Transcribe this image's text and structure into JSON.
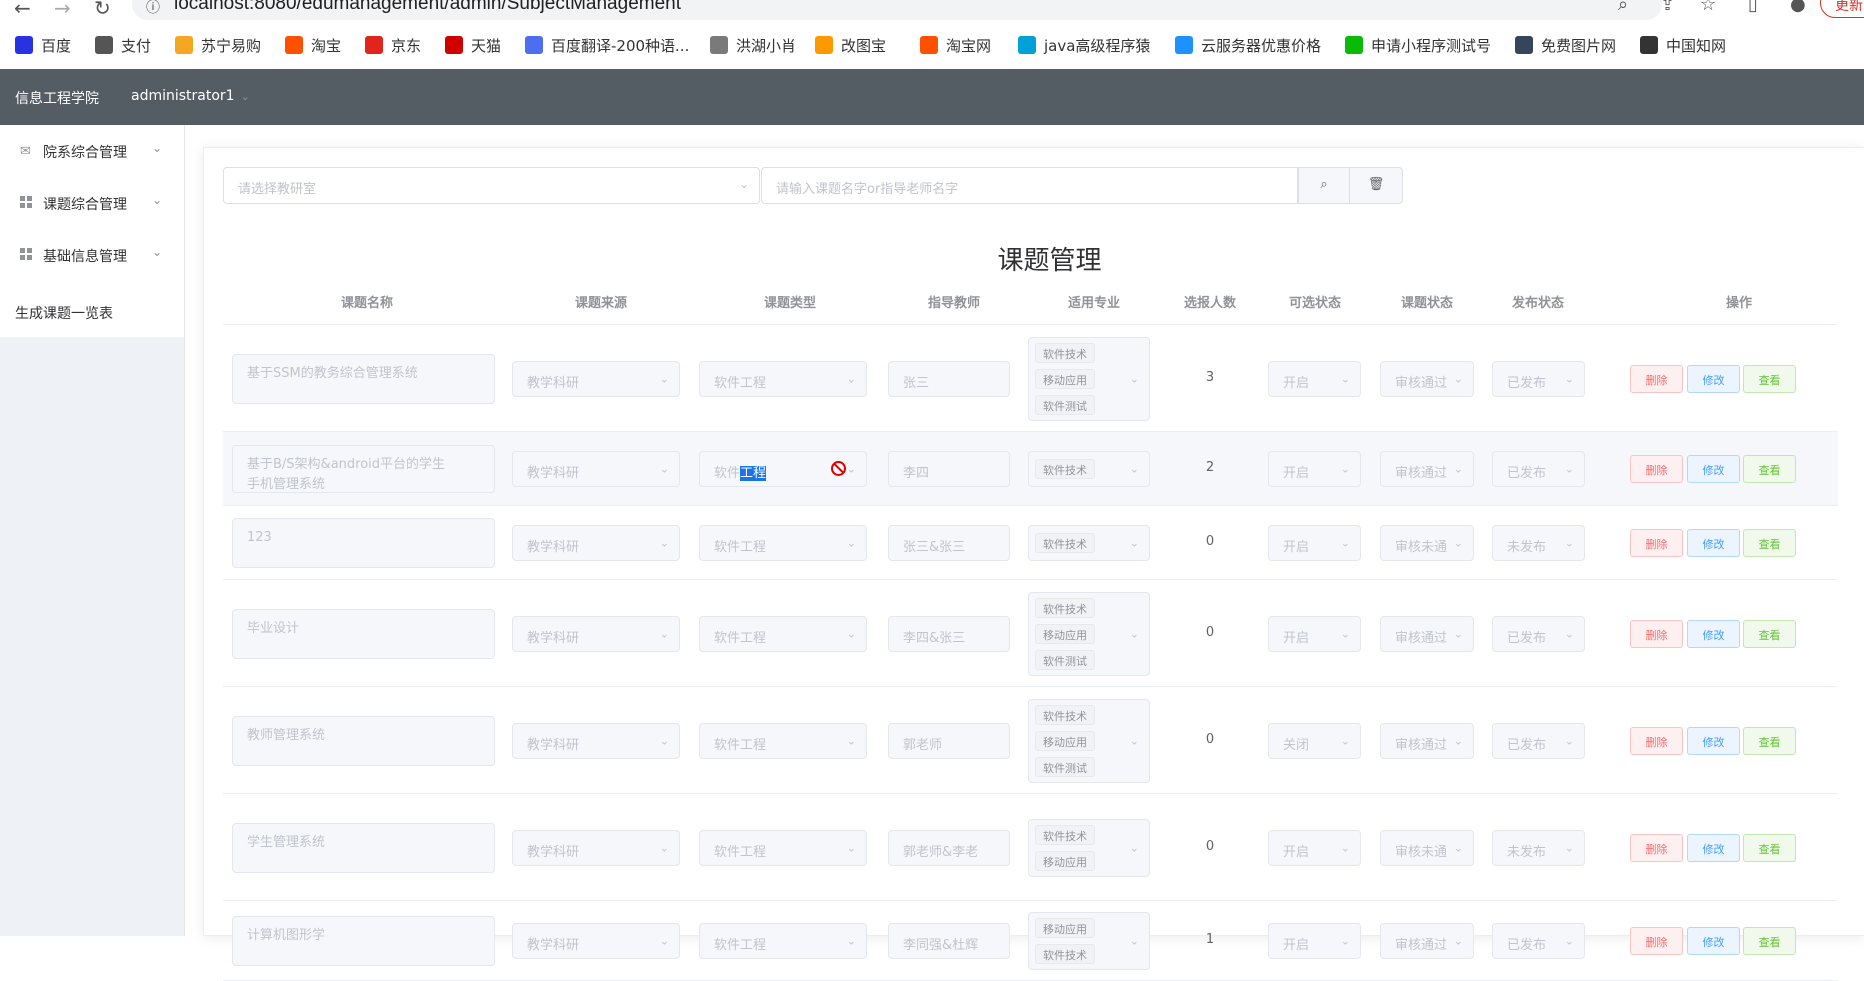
{
  "browser": {
    "url": "localhost:8080/edumanagement/admin/SubjectManagement",
    "update_label": "更新"
  },
  "bookmarks": [
    {
      "label": "百度",
      "color": "#2932e1",
      "icon": "baidu-icon"
    },
    {
      "label": "支付",
      "color": "#555555",
      "icon": "globe-icon"
    },
    {
      "label": "苏宁易购",
      "color": "#f5a623",
      "icon": "suning-icon"
    },
    {
      "label": "淘宝",
      "color": "#ff5000",
      "icon": "taobao-icon"
    },
    {
      "label": "京东",
      "color": "#e1251b",
      "icon": "jd-icon"
    },
    {
      "label": "天猫",
      "color": "#d10000",
      "icon": "tmall-icon"
    },
    {
      "label": "百度翻译-200种语...",
      "color": "#4e6ef2",
      "icon": "translate-icon"
    },
    {
      "label": "洪湖小肖",
      "color": "#7a7a7a",
      "icon": "bird-icon"
    },
    {
      "label": "改图宝",
      "color": "#ff9900",
      "icon": "gaitubao-icon"
    },
    {
      "label": "淘宝网",
      "color": "#ff5000",
      "icon": "taobao-icon"
    },
    {
      "label": "java高级程序猿",
      "color": "#00a1d6",
      "icon": "bilibili-icon"
    },
    {
      "label": "云服务器优惠价格",
      "color": "#1e90ff",
      "icon": "cloud-icon"
    },
    {
      "label": "申请小程序测试号",
      "color": "#09bb07",
      "icon": "wechat-icon"
    },
    {
      "label": "免费图片网",
      "color": "#35465c",
      "icon": "tumblr-icon"
    },
    {
      "label": "中国知网",
      "color": "#333333",
      "icon": "cnki-icon"
    }
  ],
  "header": {
    "college": "信息工程学院",
    "user": "administrator1"
  },
  "sidebar": {
    "items": [
      {
        "label": "院系综合管理",
        "icon": "mail-icon"
      },
      {
        "label": "课题综合管理",
        "icon": "grid-icon"
      },
      {
        "label": "基础信息管理",
        "icon": "grid-icon"
      }
    ],
    "plain": "生成课题一览表"
  },
  "filters": {
    "office_placeholder": "请选择教研室",
    "search_placeholder": "请输入课题名字or指导老师名字"
  },
  "title": "课题管理",
  "columns": [
    "课题名称",
    "课题来源",
    "课题类型",
    "指导教师",
    "适用专业",
    "选报人数",
    "可选状态",
    "课题状态",
    "发布状态",
    "操作"
  ],
  "actions": {
    "delete": "删除",
    "edit": "修改",
    "view": "查看"
  },
  "rows": [
    {
      "name": "基于SSM的教务综合管理系统",
      "source": "教学科研",
      "type": "软件工程",
      "teacher": "张三",
      "majors": [
        "软件技术",
        "移动应用",
        "软件测试"
      ],
      "count": "3",
      "selectable": "开启",
      "status": "审核通过",
      "publish": "已发布"
    },
    {
      "name": "基于B/S架构&android平台的学生手机管理系统",
      "source": "教学科研",
      "type_a": "软件",
      "type_b": "工程",
      "teacher": "李四",
      "majors": [
        "软件技术"
      ],
      "count": "2",
      "selectable": "开启",
      "status": "审核通过",
      "publish": "已发布"
    },
    {
      "name": "123",
      "source": "教学科研",
      "type": "软件工程",
      "teacher": "张三&张三",
      "majors": [
        "软件技术"
      ],
      "count": "0",
      "selectable": "开启",
      "status": "审核未通",
      "publish": "未发布"
    },
    {
      "name": "毕业设计",
      "source": "教学科研",
      "type": "软件工程",
      "teacher": "李四&张三",
      "majors": [
        "软件技术",
        "移动应用",
        "软件测试"
      ],
      "count": "0",
      "selectable": "开启",
      "status": "审核通过",
      "publish": "已发布"
    },
    {
      "name": "教师管理系统",
      "source": "教学科研",
      "type": "软件工程",
      "teacher": "郭老师",
      "majors": [
        "软件技术",
        "移动应用",
        "软件测试"
      ],
      "count": "0",
      "selectable": "关闭",
      "status": "审核通过",
      "publish": "已发布"
    },
    {
      "name": "学生管理系统",
      "source": "教学科研",
      "type": "软件工程",
      "teacher": "郭老师&李老",
      "majors": [
        "软件技术",
        "移动应用"
      ],
      "count": "0",
      "selectable": "开启",
      "status": "审核未通",
      "publish": "未发布"
    },
    {
      "name": "计算机图形学",
      "source": "教学科研",
      "type": "软件工程",
      "teacher": "李同强&杜辉",
      "majors": [
        "移动应用",
        "软件技术"
      ],
      "count": "1",
      "selectable": "开启",
      "status": "审核通过",
      "publish": "已发布"
    }
  ]
}
